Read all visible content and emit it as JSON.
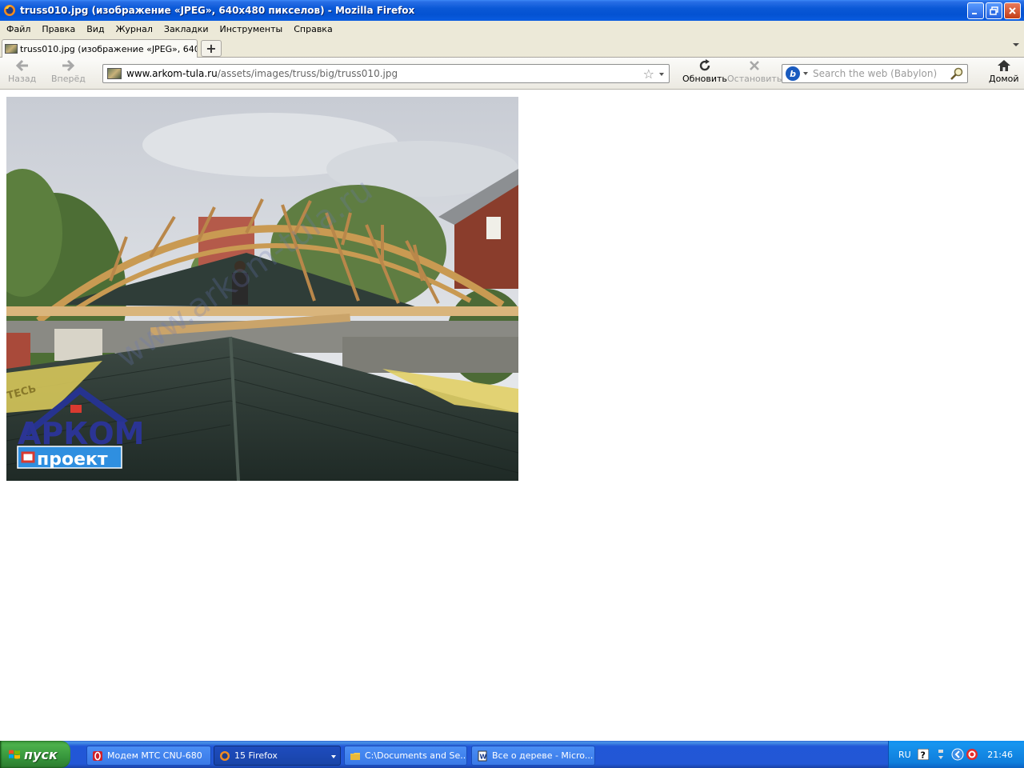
{
  "window": {
    "title": "truss010.jpg (изображение «JPEG», 640x480 пикселов) - Mozilla Firefox"
  },
  "menu": {
    "items": [
      "Файл",
      "Правка",
      "Вид",
      "Журнал",
      "Закладки",
      "Инструменты",
      "Справка"
    ]
  },
  "tabs": [
    {
      "label": "truss010.jpg (изображение «JPEG», 640x4..."
    }
  ],
  "newtab_label": "+",
  "nav": {
    "back_label": "Назад",
    "forward_label": "Вперёд",
    "reload_label": "Обновить",
    "stop_label": "Остановить",
    "home_label": "Домой",
    "url_host": "www.arkom-tula.ru",
    "url_path": "/assets/images/truss/big/truss010.jpg",
    "search_placeholder": "Search the web (Babylon)",
    "search_engine_letter": "b"
  },
  "photo": {
    "logo_line1": "АРКОМ",
    "logo_line2": "проект",
    "watermark": "www.arkom-tula.ru",
    "banner_text": "ТЕСЬ"
  },
  "taskbar": {
    "start_label": "пуск",
    "buttons": [
      {
        "label": "Модем МТС CNU-680"
      },
      {
        "label": "15 Firefox"
      },
      {
        "label": "C:\\Documents and Se..."
      },
      {
        "label": "Все о дереве - Micro..."
      }
    ],
    "lang": "RU",
    "clock": "21:46"
  },
  "colors": {
    "titlebar": "#0452d2",
    "chrome": "#ece9d8",
    "taskbar": "#2257d6",
    "start": "#37973c"
  }
}
